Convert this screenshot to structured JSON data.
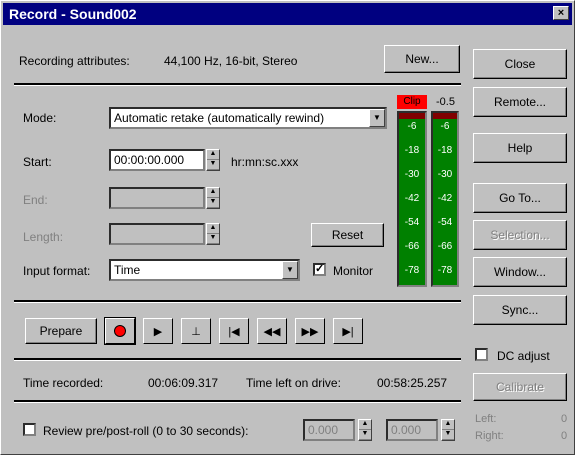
{
  "window": {
    "title": "Record - Sound002",
    "close_glyph": "×"
  },
  "attributes": {
    "label": "Recording attributes:",
    "value": "44,100 Hz, 16-bit, Stereo",
    "new_button": "New..."
  },
  "side_buttons": {
    "close": "Close",
    "remote": "Remote...",
    "help": "Help",
    "goto": "Go To...",
    "selection": "Selection...",
    "window": "Window...",
    "sync": "Sync...",
    "calibrate": "Calibrate"
  },
  "mode": {
    "label": "Mode:",
    "value": "Automatic retake (automatically rewind)"
  },
  "start": {
    "label": "Start:",
    "value": "00:00:00.000",
    "format_hint": "hr:mn:sc.xxx"
  },
  "end": {
    "label": "End:",
    "value": ""
  },
  "length": {
    "label": "Length:",
    "value": ""
  },
  "reset_button": "Reset",
  "input_format": {
    "label": "Input format:",
    "value": "Time"
  },
  "monitor": {
    "label": "Monitor",
    "checked": true,
    "glyph": "✓"
  },
  "meters": {
    "clip_label": "Clip",
    "peak_label": "-0.5",
    "scale": [
      "-6",
      "-18",
      "-30",
      "-42",
      "-54",
      "-66",
      "-78"
    ],
    "accent": "#008000",
    "clip_color": "#ff0000"
  },
  "transport": {
    "prepare_label": "Prepare",
    "icons": [
      "record-icon",
      "play-icon",
      "play-to-end-icon",
      "go-to-start-icon",
      "rewind-icon",
      "fast-forward-icon",
      "go-to-end-icon"
    ]
  },
  "time": {
    "recorded_label": "Time recorded:",
    "recorded_value": "00:06:09.317",
    "left_label": "Time left on drive:",
    "left_value": "00:58:25.257"
  },
  "dc_adjust": {
    "label": "DC adjust",
    "checked": false
  },
  "review": {
    "label": "Review pre/post-roll (0 to 30 seconds):",
    "checked": false,
    "pre_value": "0.000",
    "post_value": "0.000"
  },
  "calibration": {
    "left_label": "Left:",
    "left_value": "0",
    "right_label": "Right:",
    "right_value": "0"
  }
}
